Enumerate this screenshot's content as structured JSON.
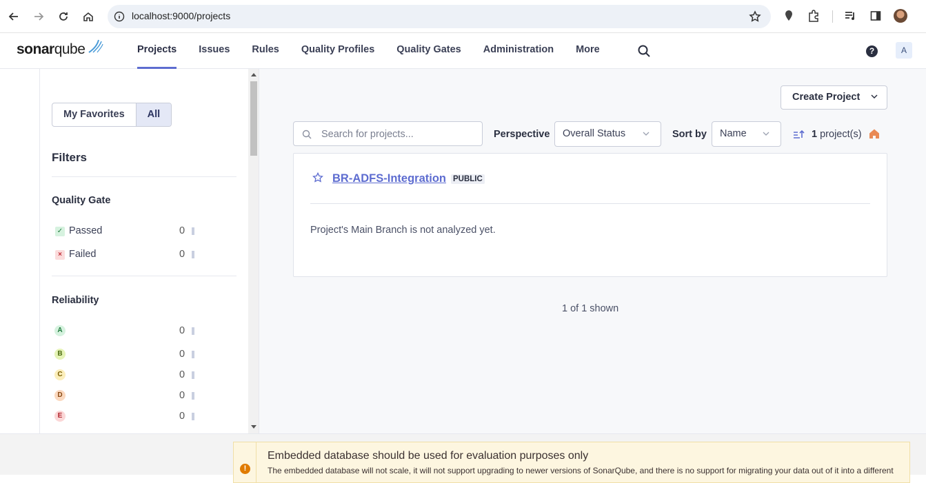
{
  "browser": {
    "url": "localhost:9000/projects"
  },
  "header": {
    "logo_text_bold": "sonar",
    "logo_text_light": "qube",
    "nav": [
      {
        "label": "Projects"
      },
      {
        "label": "Issues"
      },
      {
        "label": "Rules"
      },
      {
        "label": "Quality Profiles"
      },
      {
        "label": "Quality Gates"
      },
      {
        "label": "Administration"
      },
      {
        "label": "More"
      }
    ],
    "help": "?",
    "user_initial": "A"
  },
  "sidebar": {
    "toggle": {
      "favorites": "My Favorites",
      "all": "All"
    },
    "filters_title": "Filters",
    "quality_gate": {
      "title": "Quality Gate",
      "items": [
        {
          "label": "Passed",
          "count": "0",
          "mark": "✓"
        },
        {
          "label": "Failed",
          "count": "0",
          "mark": "×"
        }
      ]
    },
    "reliability": {
      "title": "Reliability",
      "items": [
        {
          "grade": "A",
          "count": "0",
          "color": "#d6f2df",
          "text_color": "#1f7a3c"
        },
        {
          "grade": "B",
          "count": "0",
          "color": "#e5f3b6",
          "text_color": "#4c6b10"
        },
        {
          "grade": "C",
          "count": "0",
          "color": "#fbeebb",
          "text_color": "#7a5d00"
        },
        {
          "grade": "D",
          "count": "0",
          "color": "#fbd9bf",
          "text_color": "#8a4a14"
        },
        {
          "grade": "E",
          "count": "0",
          "color": "#fbd7d7",
          "text_color": "#b0242c"
        }
      ]
    }
  },
  "main": {
    "create_project": "Create Project",
    "search_placeholder": "Search for projects...",
    "perspective_label": "Perspective",
    "perspective_value": "Overall Status",
    "sort_label": "Sort by",
    "sort_value": "Name",
    "count_number": "1",
    "count_suffix": " project(s)",
    "project": {
      "name": "BR-ADFS-Integration",
      "visibility": "PUBLIC",
      "message": "Project's Main Branch is not analyzed yet."
    },
    "shown": "1 of 1 shown"
  },
  "footer": {
    "warning_title": "Embedded database should be used for evaluation purposes only",
    "warning_text": "The embedded database will not scale, it will not support upgrading to newer versions of SonarQube, and there is no support for migrating your data out of it into a different"
  },
  "colors": {
    "accent": "#5d6cd0",
    "warning": "#e07b00"
  }
}
